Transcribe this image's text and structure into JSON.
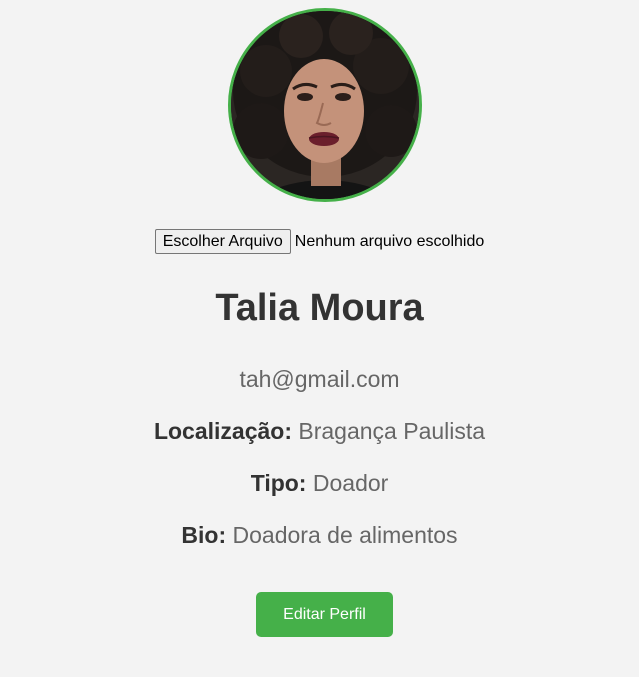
{
  "profile": {
    "name": "Talia Moura",
    "email": "tah@gmail.com",
    "location_label": "Localização:",
    "location_value": "Bragança Paulista",
    "type_label": "Tipo:",
    "type_value": "Doador",
    "bio_label": "Bio:",
    "bio_value": "Doadora de alimentos"
  },
  "file_input": {
    "button_label": "Escolher Arquivo",
    "status": "Nenhum arquivo escolhido"
  },
  "actions": {
    "edit_label": "Editar Perfil"
  },
  "colors": {
    "accent": "#45b049",
    "background": "#f3f3f3",
    "heading": "#333333",
    "muted_text": "#666666"
  }
}
